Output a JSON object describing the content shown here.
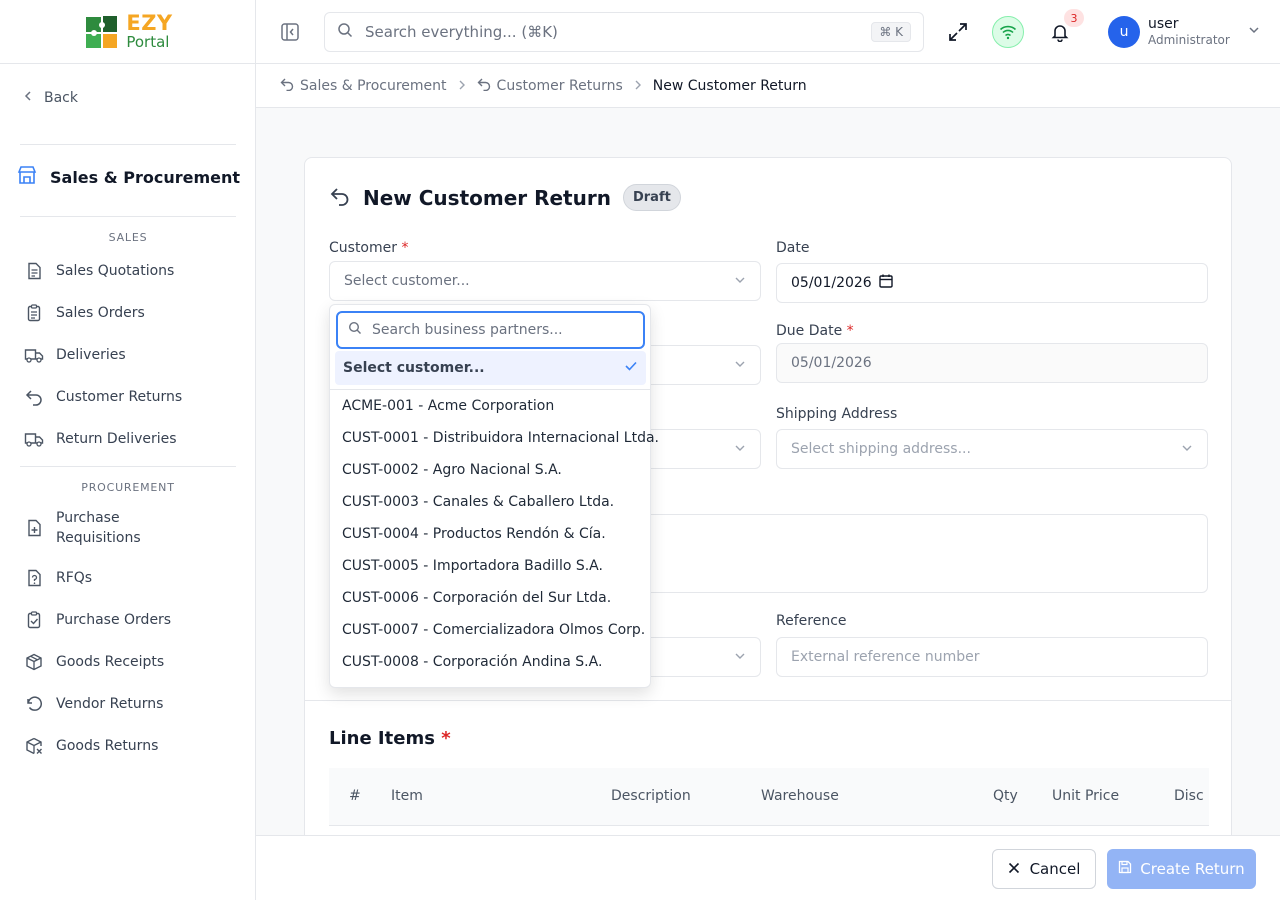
{
  "app": {
    "logo_top": "EZY",
    "logo_bottom": "Portal"
  },
  "header": {
    "search_placeholder": "Search everything... (⌘K)",
    "search_shortcut": "⌘ K",
    "notification_count": "3",
    "user": {
      "initial": "u",
      "name": "user",
      "role": "Administrator"
    }
  },
  "sidebar": {
    "back_label": "Back",
    "module_title": "Sales & Procurement",
    "sales_section": "SALES",
    "procurement_section": "PROCUREMENT",
    "sales_items": [
      {
        "label": "Sales Quotations",
        "icon": "document-icon"
      },
      {
        "label": "Sales Orders",
        "icon": "clipboard-list-icon"
      },
      {
        "label": "Deliveries",
        "icon": "truck-icon"
      },
      {
        "label": "Customer Returns",
        "icon": "undo-arrow-icon"
      },
      {
        "label": "Return Deliveries",
        "icon": "truck-icon"
      }
    ],
    "procurement_items": [
      {
        "label_line1": "Purchase",
        "label_line2": "Requisitions",
        "icon": "file-plus-icon"
      },
      {
        "label": "RFQs",
        "icon": "file-question-icon"
      },
      {
        "label": "Purchase Orders",
        "icon": "clipboard-check-icon"
      },
      {
        "label": "Goods Receipts",
        "icon": "package-icon"
      },
      {
        "label": "Vendor Returns",
        "icon": "rotate-ccw-icon"
      },
      {
        "label": "Goods Returns",
        "icon": "package-x-icon"
      }
    ]
  },
  "breadcrumb": [
    "Sales & Procurement",
    "Customer Returns",
    "New Customer Return"
  ],
  "form": {
    "title": "New Customer Return",
    "status": "Draft",
    "customer_label": "Customer",
    "customer_placeholder": "Select customer...",
    "date_label": "Date",
    "date_value": "05/01/2026",
    "due_date_label": "Due Date",
    "due_date_value": "05/01/2026",
    "shipping_label": "Shipping Address",
    "shipping_placeholder": "Select shipping address...",
    "reference_label": "Reference",
    "reference_placeholder": "External reference number",
    "required_mark": "*"
  },
  "line_items": {
    "title": "Line Items",
    "columns": [
      "#",
      "Item",
      "Description",
      "Warehouse",
      "Qty",
      "Unit Price",
      "Disc"
    ]
  },
  "dropdown": {
    "search_placeholder": "Search business partners...",
    "selected": "Select customer...",
    "options": [
      "ACME-001 - Acme Corporation",
      "CUST-0001 - Distribuidora Internacional Ltda.",
      "CUST-0002 - Agro Nacional S.A.",
      "CUST-0003 - Canales & Caballero Ltda.",
      "CUST-0004 - Productos Rendón & Cía.",
      "CUST-0005 - Importadora Badillo S.A.",
      "CUST-0006 - Corporación del Sur Ltda.",
      "CUST-0007 - Comercializadora Olmos Corp.",
      "CUST-0008 - Corporación Andina S.A."
    ]
  },
  "footer": {
    "cancel_label": "Cancel",
    "create_label": "Create Return"
  },
  "colors": {
    "accent": "#3b82f6",
    "create_button": "#93b4f5",
    "required": "#dc2626",
    "logo_orange": "#f5a623",
    "logo_green": "#2e8b3e"
  }
}
